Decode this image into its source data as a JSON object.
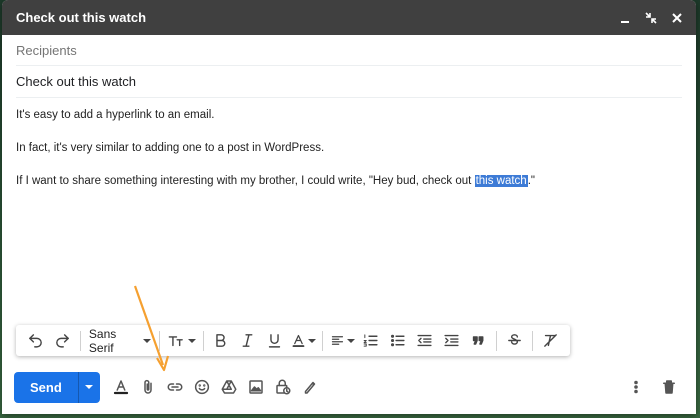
{
  "window": {
    "title": "Check out this watch"
  },
  "fields": {
    "recipients_placeholder": "Recipients",
    "subject": "Check out this watch"
  },
  "body": {
    "line1": "It's easy to add a hyperlink to an email.",
    "line2": "In fact, it's very similar to adding one to a post in WordPress.",
    "line3_before": "If I want to share something interesting with my brother, I could write, \"Hey bud, check out ",
    "line3_selected": "this watch",
    "line3_after": ".\""
  },
  "formatting": {
    "font_name": "Sans Serif",
    "icons": [
      "undo-icon",
      "redo-icon",
      "font-select",
      "text-size-icon",
      "bold-icon",
      "italic-icon",
      "underline-icon",
      "text-color-icon",
      "align-icon",
      "numbered-list-icon",
      "bulleted-list-icon",
      "indent-less-icon",
      "indent-more-icon",
      "quote-icon",
      "strikethrough-icon",
      "remove-formatting-icon"
    ]
  },
  "bottom": {
    "send_label": "Send",
    "icons": [
      "formatting-toggle-icon",
      "attach-icon",
      "link-icon",
      "emoji-icon",
      "drive-icon",
      "photo-icon",
      "confidential-icon",
      "signature-icon",
      "more-options-icon",
      "trash-icon"
    ]
  },
  "colors": {
    "titlebar": "#404040",
    "send": "#1a73e8",
    "selection": "#3d7bd6",
    "annotation_arrow": "#f5a030"
  }
}
